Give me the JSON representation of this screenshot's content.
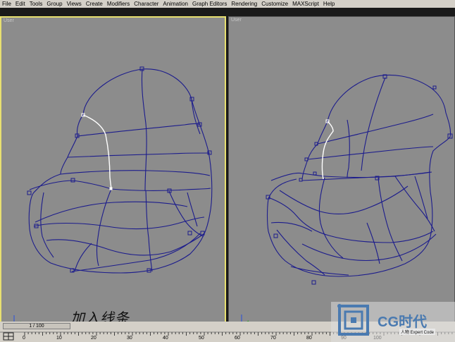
{
  "menu": [
    "File",
    "Edit",
    "Tools",
    "Group",
    "Views",
    "Create",
    "Modifiers",
    "Character",
    "Animation",
    "Graph Editors",
    "Rendering",
    "Customize",
    "MAXScript",
    "Help"
  ],
  "viewports": {
    "left_label": "User",
    "right_label": "User",
    "caption": "加入线条"
  },
  "timeline": {
    "slider_text": "1 / 100",
    "ticks": [
      "0",
      "10",
      "20",
      "30",
      "40",
      "50",
      "60",
      "70",
      "80",
      "90",
      "100"
    ]
  },
  "logo": {
    "brand": "CG时代",
    "sub": "人物 Expert Code"
  },
  "colors": {
    "curve": "#1c1c8c",
    "selected_curve": "#ffffff",
    "active_border": "#e8e070",
    "viewport_bg": "#8c8c8c"
  }
}
